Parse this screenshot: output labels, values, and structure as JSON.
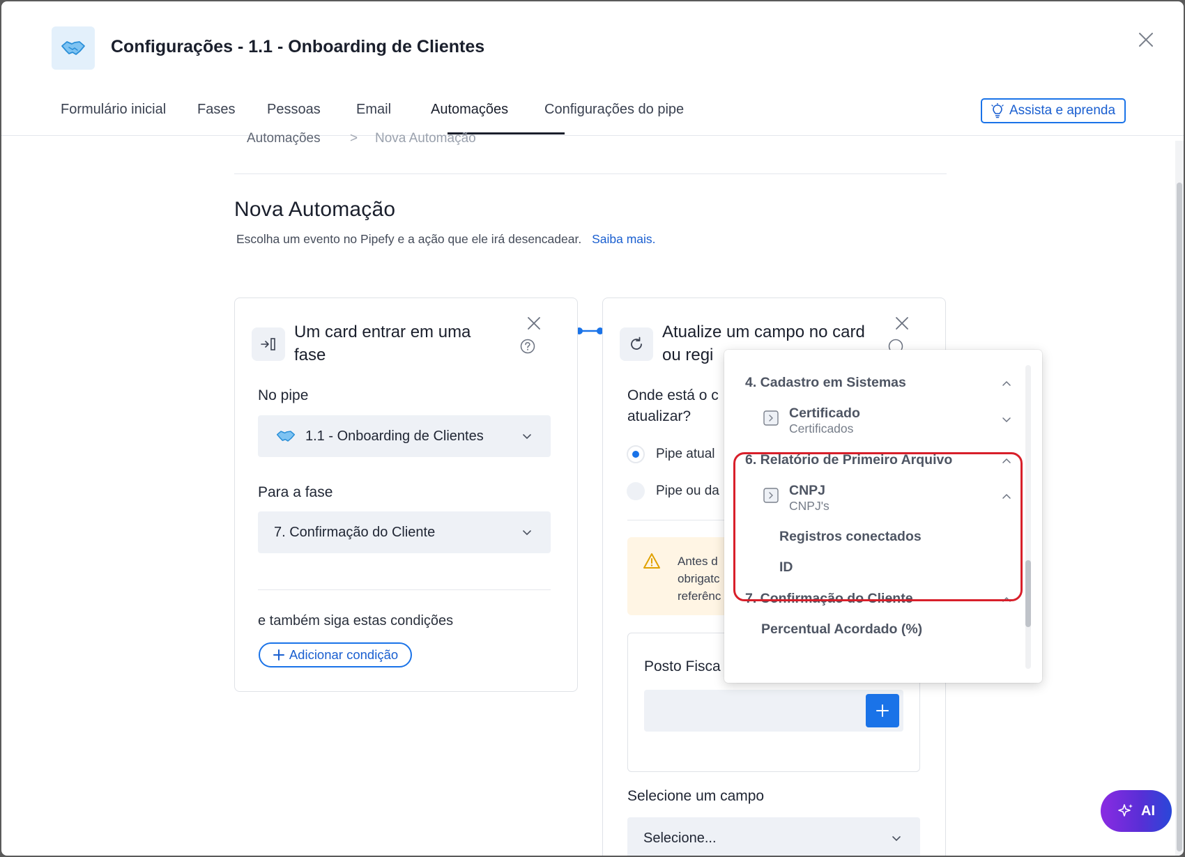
{
  "header": {
    "title": "Configurações - 1.1 - Onboarding de Clientes"
  },
  "tabs": [
    {
      "label": "Formulário inicial"
    },
    {
      "label": "Fases"
    },
    {
      "label": "Pessoas"
    },
    {
      "label": "Email"
    },
    {
      "label": "Automações"
    },
    {
      "label": "Configurações do pipe"
    }
  ],
  "active_tab": "Automações",
  "learn_button": "Assista e aprenda",
  "breadcrumb": {
    "root": "Automações",
    "separator": ">",
    "current": "Nova Automação"
  },
  "page": {
    "title": "Nova Automação",
    "subtitle": "Escolha um evento no Pipefy e a ação que ele irá desencadear.",
    "learn_more": "Saiba mais."
  },
  "event_card": {
    "title_line1": "Um card entrar em uma",
    "title_line2": "fase",
    "pipe_label": "No pipe",
    "pipe_value": "1.1 - Onboarding de Clientes",
    "phase_label": "Para a fase",
    "phase_value": "7. Confirmação do Cliente",
    "conditions_label": "e também siga estas condições",
    "add_condition": "Adicionar condição"
  },
  "action_card": {
    "title_line1": "Atualize um campo no card",
    "title_line2": "ou regi",
    "where_line1": "Onde está o c",
    "where_line2": "atualizar?",
    "radio_current": "Pipe atual",
    "radio_other": "Pipe ou da",
    "warning_text": "Antes d\nobrigatc\nreferênc",
    "posto_label": "Posto Fisca",
    "select_field_label": "Selecione um campo",
    "select_field_placeholder": "Selecione..."
  },
  "dropdown": {
    "sections": [
      {
        "title": "4. Cadastro em Sistemas",
        "items": [
          {
            "title": "Certificado",
            "subtitle": "Certificados"
          }
        ]
      },
      {
        "title": "6. Relatório de Primeiro Arquivo",
        "items": [
          {
            "title": "CNPJ",
            "subtitle": "CNPJ's"
          }
        ],
        "leaves": [
          "Registros conectados",
          "ID"
        ]
      },
      {
        "title": "7. Confirmação do Cliente",
        "leaves": [
          "Percentual Acordado (%)"
        ]
      }
    ]
  },
  "ai_button": "AI",
  "colors": {
    "accent": "#1a73e8",
    "highlight": "#d81f2a",
    "warning_bg": "#fff5e4"
  }
}
